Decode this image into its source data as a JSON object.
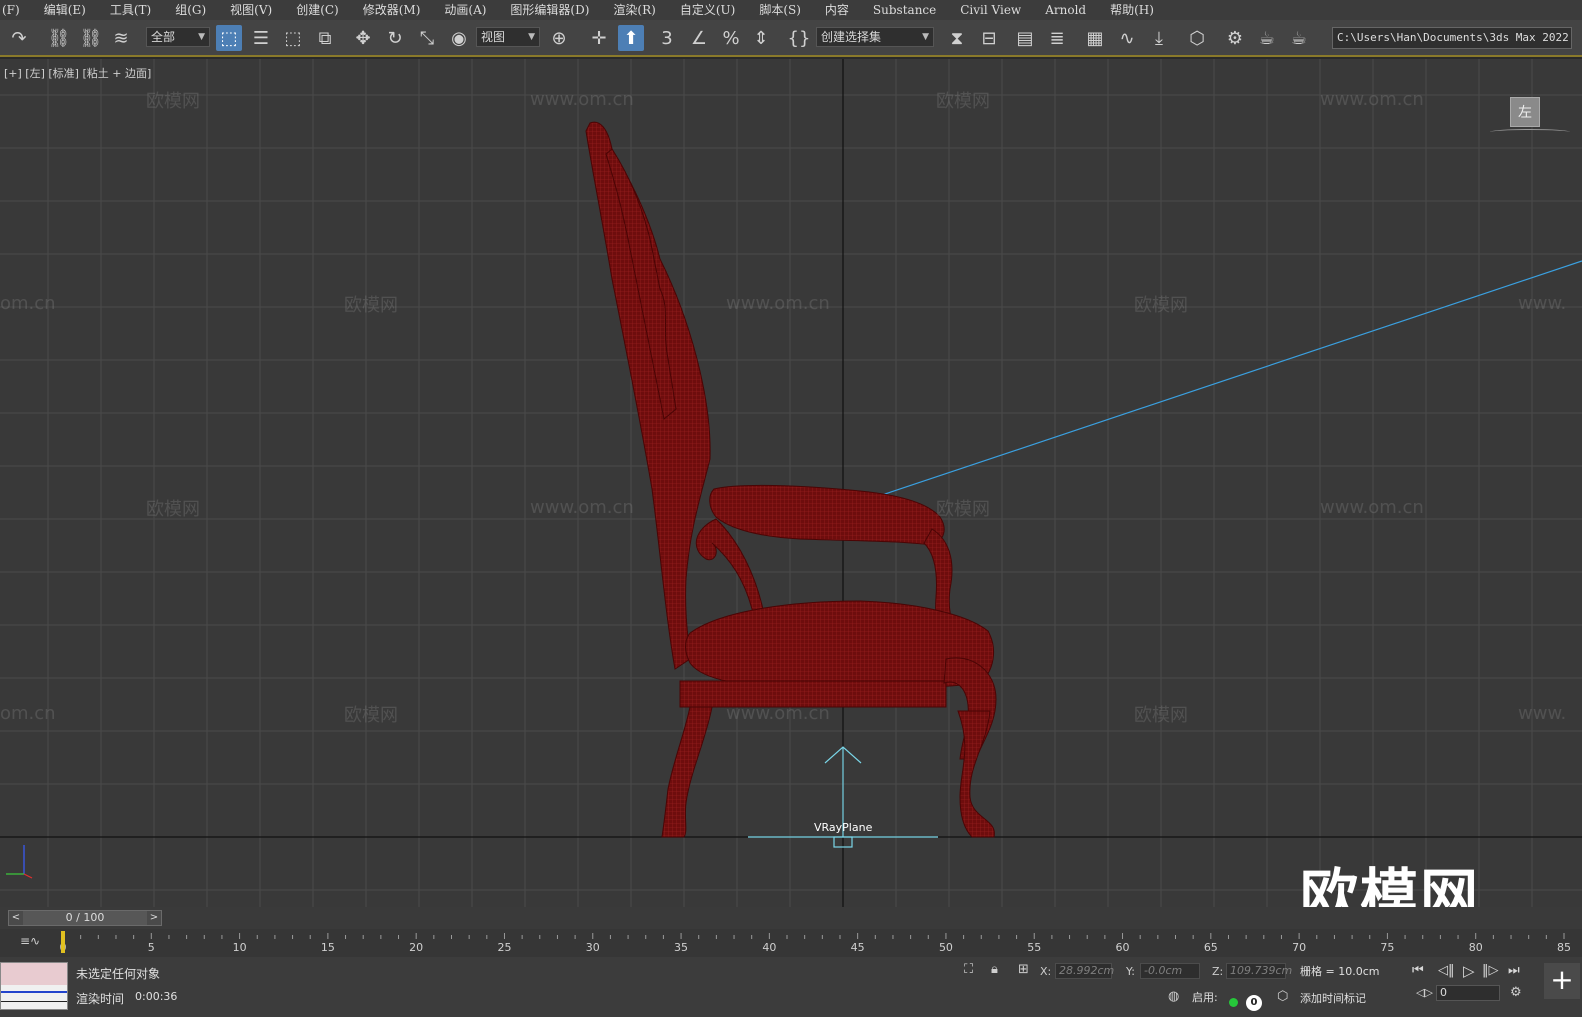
{
  "menubar": {
    "items": [
      "(F)",
      "编辑(E)",
      "工具(T)",
      "组(G)",
      "视图(V)",
      "创建(C)",
      "修改器(M)",
      "动画(A)",
      "图形编辑器(D)",
      "渲染(R)",
      "自定义(U)",
      "脚本(S)",
      "内容",
      "Substance",
      "Civil View",
      "Arnold",
      "帮助(H)"
    ]
  },
  "toolbar": {
    "selection_filter": "全部",
    "reference_coord": "视图",
    "named_selection": "创建选择集",
    "path": "C:\\Users\\Han\\Documents\\3ds Max 2022",
    "icons": [
      "redo-icon",
      "link-icon",
      "unlink-icon",
      "bind-spacewarp-icon",
      "select-object-icon",
      "select-by-name-icon",
      "rect-selection-icon",
      "window-crossing-icon",
      "move-icon",
      "rotate-icon",
      "scale-icon",
      "place-icon",
      "pivot-icon",
      "snap-toggle-icon",
      "angle-snap-icon",
      "percent-snap-icon",
      "spinner-snap-icon",
      "edit-named-sets-icon",
      "mirror-icon",
      "align-icon",
      "scene-explorer-icon",
      "layer-explorer-icon",
      "ribbon-icon",
      "curve-editor-icon",
      "schematic-view-icon",
      "material-editor-icon",
      "render-setup-icon",
      "render-frame-icon",
      "render-icon"
    ]
  },
  "viewport": {
    "label": "[+] [左] [标准] [粘土 + 边面]",
    "viewcube_label": "左",
    "object_label": "VRayPlane",
    "watermark_text": "欧模网",
    "watermark_url": "www.om.cn",
    "watermark_url_short": "om.cn",
    "watermark_url_www": "www.",
    "big_logo": "欧模网",
    "axis_z": "z",
    "axis_y": "y",
    "colors": {
      "background": "#393939",
      "grid": "#4a4a4a",
      "model": "#7a1010",
      "vray_plane": "#7ad6e8",
      "light_line": "#3aa0e0"
    }
  },
  "timeline": {
    "slider_value": "0 / 100",
    "prev": "<",
    "next": ">",
    "ticks": [
      "0",
      "5",
      "10",
      "15",
      "20",
      "25",
      "30",
      "35",
      "40",
      "45",
      "50",
      "55",
      "60",
      "65",
      "70",
      "75",
      "80",
      "85"
    ]
  },
  "status": {
    "selection": "未选定任何对象",
    "render_time_label": "渲染时间",
    "render_time": "0:00:36",
    "x_label": "X:",
    "x_value": "28.992cm",
    "y_label": "Y:",
    "y_value": "-0.0cm",
    "z_label": "Z:",
    "z_value": "109.739cm",
    "grid": "栅格 = 10.0cm",
    "enable_label": "启用:",
    "enable_count": "0",
    "add_time_tag": "添加时间标记",
    "frame": "0"
  }
}
